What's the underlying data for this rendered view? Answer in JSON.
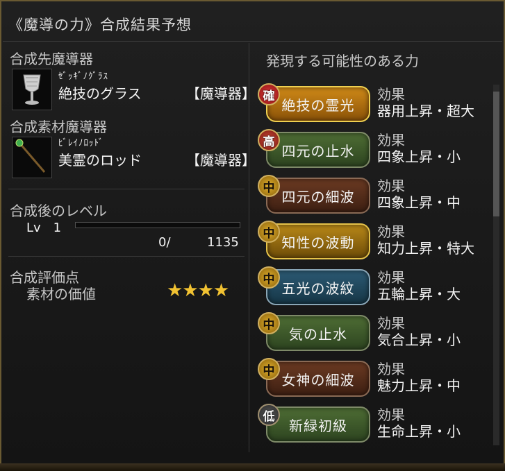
{
  "window": {
    "title": "《魔導の力》合成結果予想"
  },
  "left": {
    "target_label": "合成先魔導器",
    "target": {
      "ruby": "ｾﾞｯｷﾞﾉｸﾞﾗｽ",
      "name": "絶技のグラス",
      "type": "【魔導器】",
      "icon": "goblet-icon"
    },
    "material_label": "合成素材魔導器",
    "material": {
      "ruby": "ﾋﾞﾚｲﾉﾛｯﾄﾞ",
      "name": "美霊のロッド",
      "type": "【魔導器】",
      "icon": "rod-icon"
    },
    "level_label": "合成後のレベル",
    "level_text": "Lv　1",
    "exp_current": "0/",
    "exp_max": "1135",
    "exp_progress": 0,
    "score_label": "合成評価点",
    "material_value_label": "素材の価値",
    "stars": "★★★★",
    "star_count": 4
  },
  "right": {
    "header": "発現する可能性のある力",
    "effect_label": "効果",
    "powers": [
      {
        "badge": "確",
        "name": "絶技の霊光",
        "effect": "器用上昇・超大"
      },
      {
        "badge": "高",
        "name": "四元の止水",
        "effect": "四象上昇・小"
      },
      {
        "badge": "中",
        "name": "四元の細波",
        "effect": "四象上昇・中"
      },
      {
        "badge": "中",
        "name": "知性の波動",
        "effect": "知力上昇・特大"
      },
      {
        "badge": "中",
        "name": "五光の波紋",
        "effect": "五輪上昇・大"
      },
      {
        "badge": "中",
        "name": "気の止水",
        "effect": "気合上昇・小"
      },
      {
        "badge": "中",
        "name": "女神の細波",
        "effect": "魅力上昇・中"
      },
      {
        "badge": "低",
        "name": "新緑初級",
        "effect": "生命上昇・小"
      }
    ]
  }
}
